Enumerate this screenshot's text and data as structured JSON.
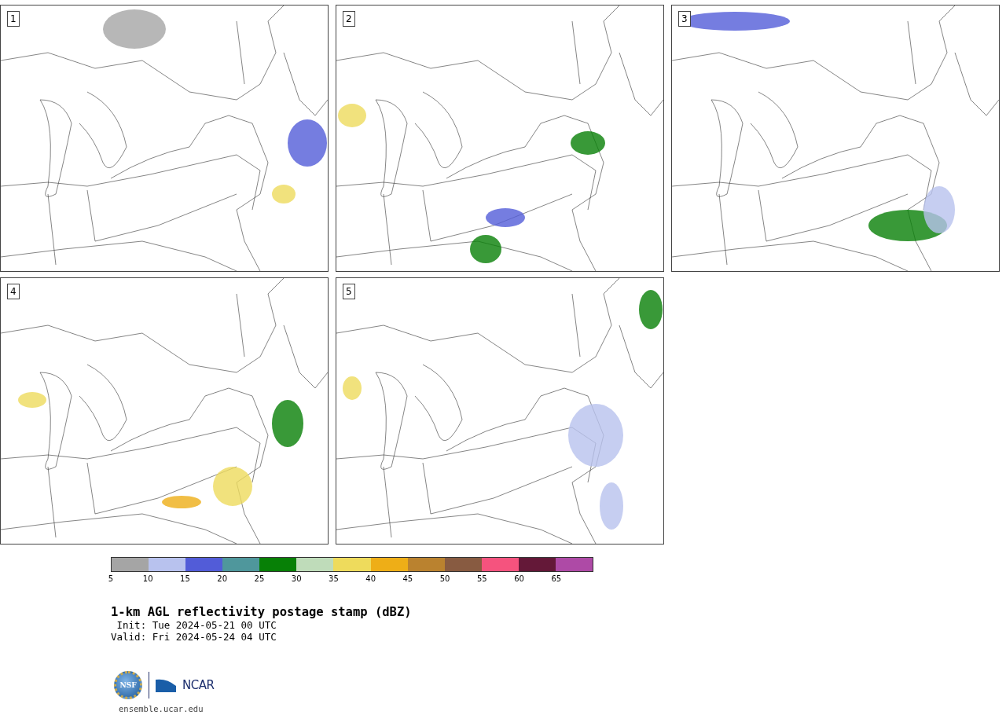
{
  "panels": [
    {
      "label": "1"
    },
    {
      "label": "2"
    },
    {
      "label": "3"
    },
    {
      "label": "4"
    },
    {
      "label": "5"
    }
  ],
  "colorbar": {
    "segments": [
      {
        "color": "#a5a5a5",
        "label": "5"
      },
      {
        "color": "#b8c2ee",
        "label": "10"
      },
      {
        "color": "#525cd8",
        "label": "15"
      },
      {
        "color": "#4f979c",
        "label": "20"
      },
      {
        "color": "#078006",
        "label": "25"
      },
      {
        "color": "#bfdcba",
        "label": "30"
      },
      {
        "color": "#eedb5c",
        "label": "35"
      },
      {
        "color": "#eeae17",
        "label": "40"
      },
      {
        "color": "#ba822f",
        "label": "45"
      },
      {
        "color": "#885b41",
        "label": "50"
      },
      {
        "color": "#f5537e",
        "label": "55"
      },
      {
        "color": "#641838",
        "label": "60"
      },
      {
        "color": "#ae4aa6",
        "label": "65"
      }
    ]
  },
  "title": "1-km AGL reflectivity postage stamp (dBZ)",
  "init": " Init: Tue 2024-05-21 00 UTC",
  "valid": "Valid: Fri 2024-05-24 04 UTC",
  "logo": {
    "seal_text": "NSF",
    "wordmark": "NCAR"
  },
  "footer": "ensemble.ucar.edu"
}
